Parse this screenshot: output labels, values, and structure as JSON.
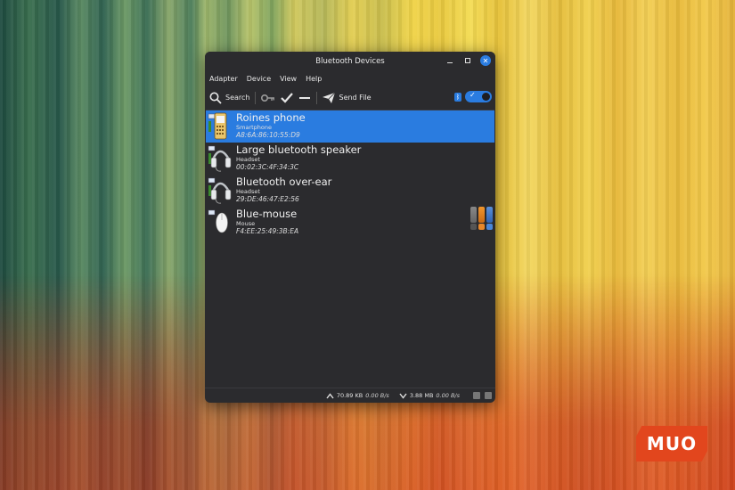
{
  "window": {
    "title": "Bluetooth Devices"
  },
  "menu": [
    "Adapter",
    "Device",
    "View",
    "Help"
  ],
  "toolbar": {
    "search_label": "Search",
    "send_file_label": "Send File"
  },
  "devices": [
    {
      "name": "Roines phone",
      "type": "Smartphone",
      "address": "A8:6A:86:10:55:D9",
      "icon": "phone-icon",
      "selected": true
    },
    {
      "name": "Large bluetooth speaker",
      "type": "Headset",
      "address": "00:02:3C:4F:34:3C",
      "icon": "headset-icon",
      "selected": false
    },
    {
      "name": "Bluetooth over-ear",
      "type": "Headset",
      "address": "29:DE:46:47:E2:56",
      "icon": "headset-icon",
      "selected": false
    },
    {
      "name": "Blue-mouse",
      "type": "Mouse",
      "address": "F4:EE:25:49:3B:EA",
      "icon": "mouse-icon",
      "selected": false
    }
  ],
  "status": {
    "upload_total": "70.89 KB",
    "upload_rate": "0.00 B/s",
    "download_total": "3.88 MB",
    "download_rate": "0.00 B/s"
  },
  "watermark": "MUO",
  "colors": {
    "accent": "#2a7ce0",
    "window_bg": "#2b2b2e",
    "logo": "#e2461d"
  }
}
